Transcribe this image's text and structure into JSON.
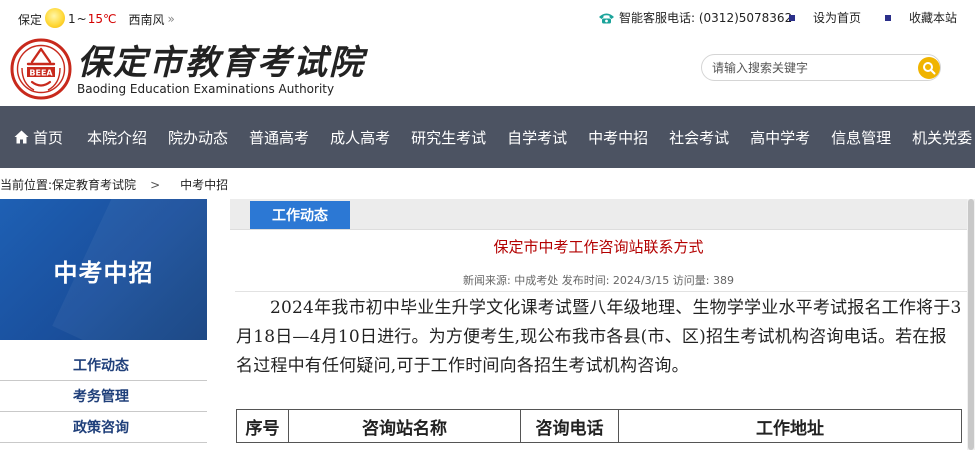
{
  "topbar": {
    "city": "保定",
    "temp_low": "1",
    "temp_sep": "~",
    "temp_high": "15℃",
    "wind": "西南风",
    "wind_more": "»",
    "hotline": "智能客服电话: (0312)5078362",
    "links": [
      "设为首页",
      "收藏本站"
    ],
    "icons": {
      "weather": "sun-icon",
      "phone": "phone-icon"
    }
  },
  "header": {
    "logo_cn": "保定市教育考试院",
    "logo_en": "Baoding Education Examinations Authority",
    "logo_badge": "BEEA",
    "search_placeholder": "请输入搜索关键字",
    "search_icon": "search-icon"
  },
  "nav": {
    "items": [
      "首页",
      "本院介绍",
      "院办动态",
      "普通高考",
      "成人高考",
      "研究生考试",
      "自学考试",
      "中考中招",
      "社会考试",
      "高中学考",
      "信息管理",
      "机关党委"
    ]
  },
  "breadcrumb": {
    "prefix": "当前位置:",
    "items": [
      "保定教育考试院",
      "中考中招"
    ],
    "separator": ">"
  },
  "sidebar": {
    "title": "中考中招",
    "items": [
      "工作动态",
      "考务管理",
      "政策咨询"
    ]
  },
  "article": {
    "tab": "工作动态",
    "title": "保定市中考工作咨询站联系方式",
    "meta": "新闻来源: 中成考处 发布时间: 2024/3/15 访问量: 389",
    "body": "2024年我市初中毕业生升学文化课考试暨八年级地理、生物学学业水平考试报名工作将于3月18日—4月10日进行。为方便考生,现公布我市各县(市、区)招生考试机构咨询电话。若在报名过程中有任何疑问,可于工作时间向各招生考试机构咨询。",
    "table_headers": [
      "序号",
      "咨询站名称",
      "咨询电话",
      "工作地址"
    ]
  },
  "colors": {
    "nav_bg": "#4c5362",
    "accent_blue": "#2c78d4",
    "title_red": "#b30000",
    "sidebar_text": "#1f3f7a",
    "temp_high": "#d40000"
  }
}
